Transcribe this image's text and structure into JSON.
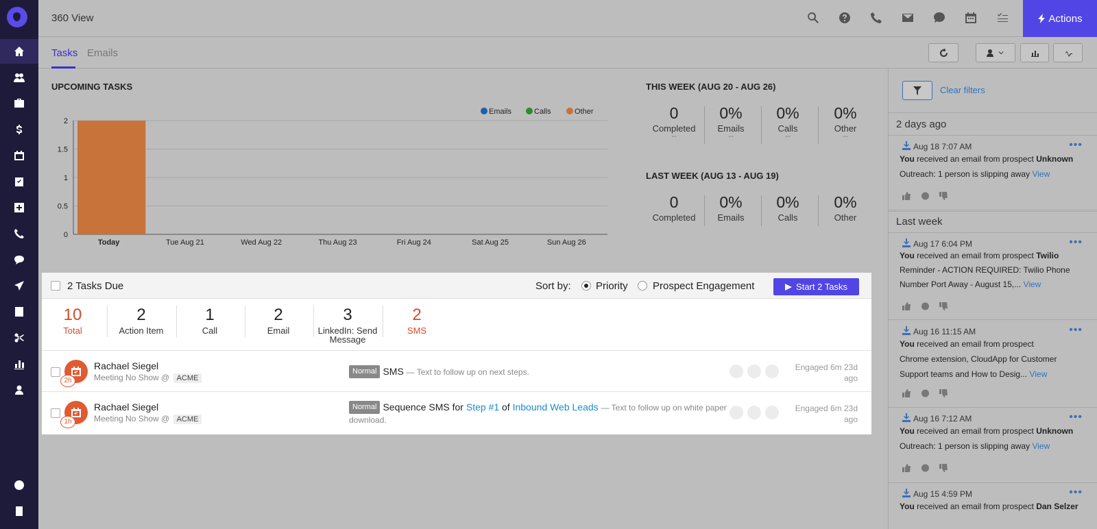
{
  "header": {
    "title": "360 View",
    "actions_label": "Actions"
  },
  "tabs": [
    {
      "label": "Tasks"
    },
    {
      "label": "Emails"
    }
  ],
  "upcoming": {
    "title": "UPCOMING TASKS"
  },
  "chart_data": {
    "type": "bar",
    "categories": [
      "Today",
      "Tue Aug 21",
      "Wed Aug 22",
      "Thu Aug 23",
      "Fri Aug 24",
      "Sat Aug 25",
      "Sun Aug 26"
    ],
    "series": [
      {
        "name": "Emails",
        "color": "#1f5fa8",
        "values": [
          0,
          0,
          0,
          0,
          0,
          0,
          0
        ]
      },
      {
        "name": "Calls",
        "color": "#2e8b2e",
        "values": [
          0,
          0,
          0,
          0,
          0,
          0,
          0
        ]
      },
      {
        "name": "Other",
        "color": "#c8733a",
        "values": [
          2,
          0,
          0,
          0,
          0,
          0,
          0
        ]
      }
    ],
    "ylim": [
      0,
      2
    ],
    "yticks": [
      "0",
      "0.5",
      "1",
      "1.5",
      "2"
    ],
    "legend": "top-right",
    "grid": true
  },
  "this_week": {
    "title": "THIS WEEK (AUG 20 - AUG 26)",
    "stats": [
      {
        "value": "0",
        "label": "Completed",
        "delta": "--"
      },
      {
        "value": "0%",
        "label": "Emails",
        "delta": "--"
      },
      {
        "value": "0%",
        "label": "Calls",
        "delta": "--"
      },
      {
        "value": "0%",
        "label": "Other",
        "delta": "--"
      }
    ]
  },
  "last_week": {
    "title": "LAST WEEK (AUG 13 - AUG 19)",
    "stats": [
      {
        "value": "0",
        "label": "Completed"
      },
      {
        "value": "0%",
        "label": "Emails"
      },
      {
        "value": "0%",
        "label": "Calls"
      },
      {
        "value": "0%",
        "label": "Other"
      }
    ]
  },
  "tasks_panel": {
    "due_label": "2 Tasks Due",
    "sort_label": "Sort by:",
    "sort_options": [
      "Priority",
      "Prospect Engagement"
    ],
    "start_label": "Start 2 Tasks",
    "counts": [
      {
        "value": "10",
        "label": "Total"
      },
      {
        "value": "2",
        "label": "Action Item"
      },
      {
        "value": "1",
        "label": "Call"
      },
      {
        "value": "2",
        "label": "Email"
      },
      {
        "value": "3",
        "label": "LinkedIn: Send Message"
      },
      {
        "value": "2",
        "label": "SMS"
      }
    ],
    "rows": [
      {
        "name": "Rachael Siegel",
        "sub": "Meeting No Show @",
        "company": "ACME",
        "badge": "2h",
        "priority": "Normal",
        "desc_main": "SMS",
        "desc_note": "— Text to follow up on next steps.",
        "engaged": "Engaged 6m 23d ago"
      },
      {
        "name": "Rachael Siegel",
        "sub": "Meeting No Show @",
        "company": "ACME",
        "badge": "1h",
        "priority": "Normal",
        "desc_pre": "Sequence SMS for",
        "desc_step": "Step #1",
        "desc_of": "of",
        "desc_seq": "Inbound Web Leads",
        "desc_note": "— Text to follow up on white paper download.",
        "engaged": "Engaged 6m 23d ago"
      }
    ]
  },
  "feed": {
    "clear_filters": "Clear filters",
    "groups": [
      {
        "label": "2 days ago"
      },
      {
        "label": "Last week"
      }
    ],
    "items": [
      {
        "date": "Aug 18 7:07 AM",
        "you": "You",
        "text": "received an email from prospect",
        "prospect": "Unknown",
        "subject": "Outreach: 1 person is slipping away",
        "view": "View"
      },
      {
        "date": "Aug 17 6:04 PM",
        "you": "You",
        "text": "received an email from prospect",
        "prospect": "Twilio",
        "subject": "Reminder - ACTION REQUIRED: Twilio Phone Number Port Away - August 15,...",
        "view": "View"
      },
      {
        "date": "Aug 16 11:15 AM",
        "you": "You",
        "text": "received an email from prospect",
        "prospect": "",
        "subject": "Chrome extension, CloudApp for Customer Support teams and How to Desig...",
        "view": "View"
      },
      {
        "date": "Aug 16 7:12 AM",
        "you": "You",
        "text": "received an email from prospect",
        "prospect": "Unknown",
        "subject": "Outreach: 1 person is slipping away",
        "view": "View"
      },
      {
        "date": "Aug 15 4:59 PM",
        "you": "You",
        "text": "received an email from prospect",
        "prospect": "Dan Selzer"
      }
    ]
  }
}
